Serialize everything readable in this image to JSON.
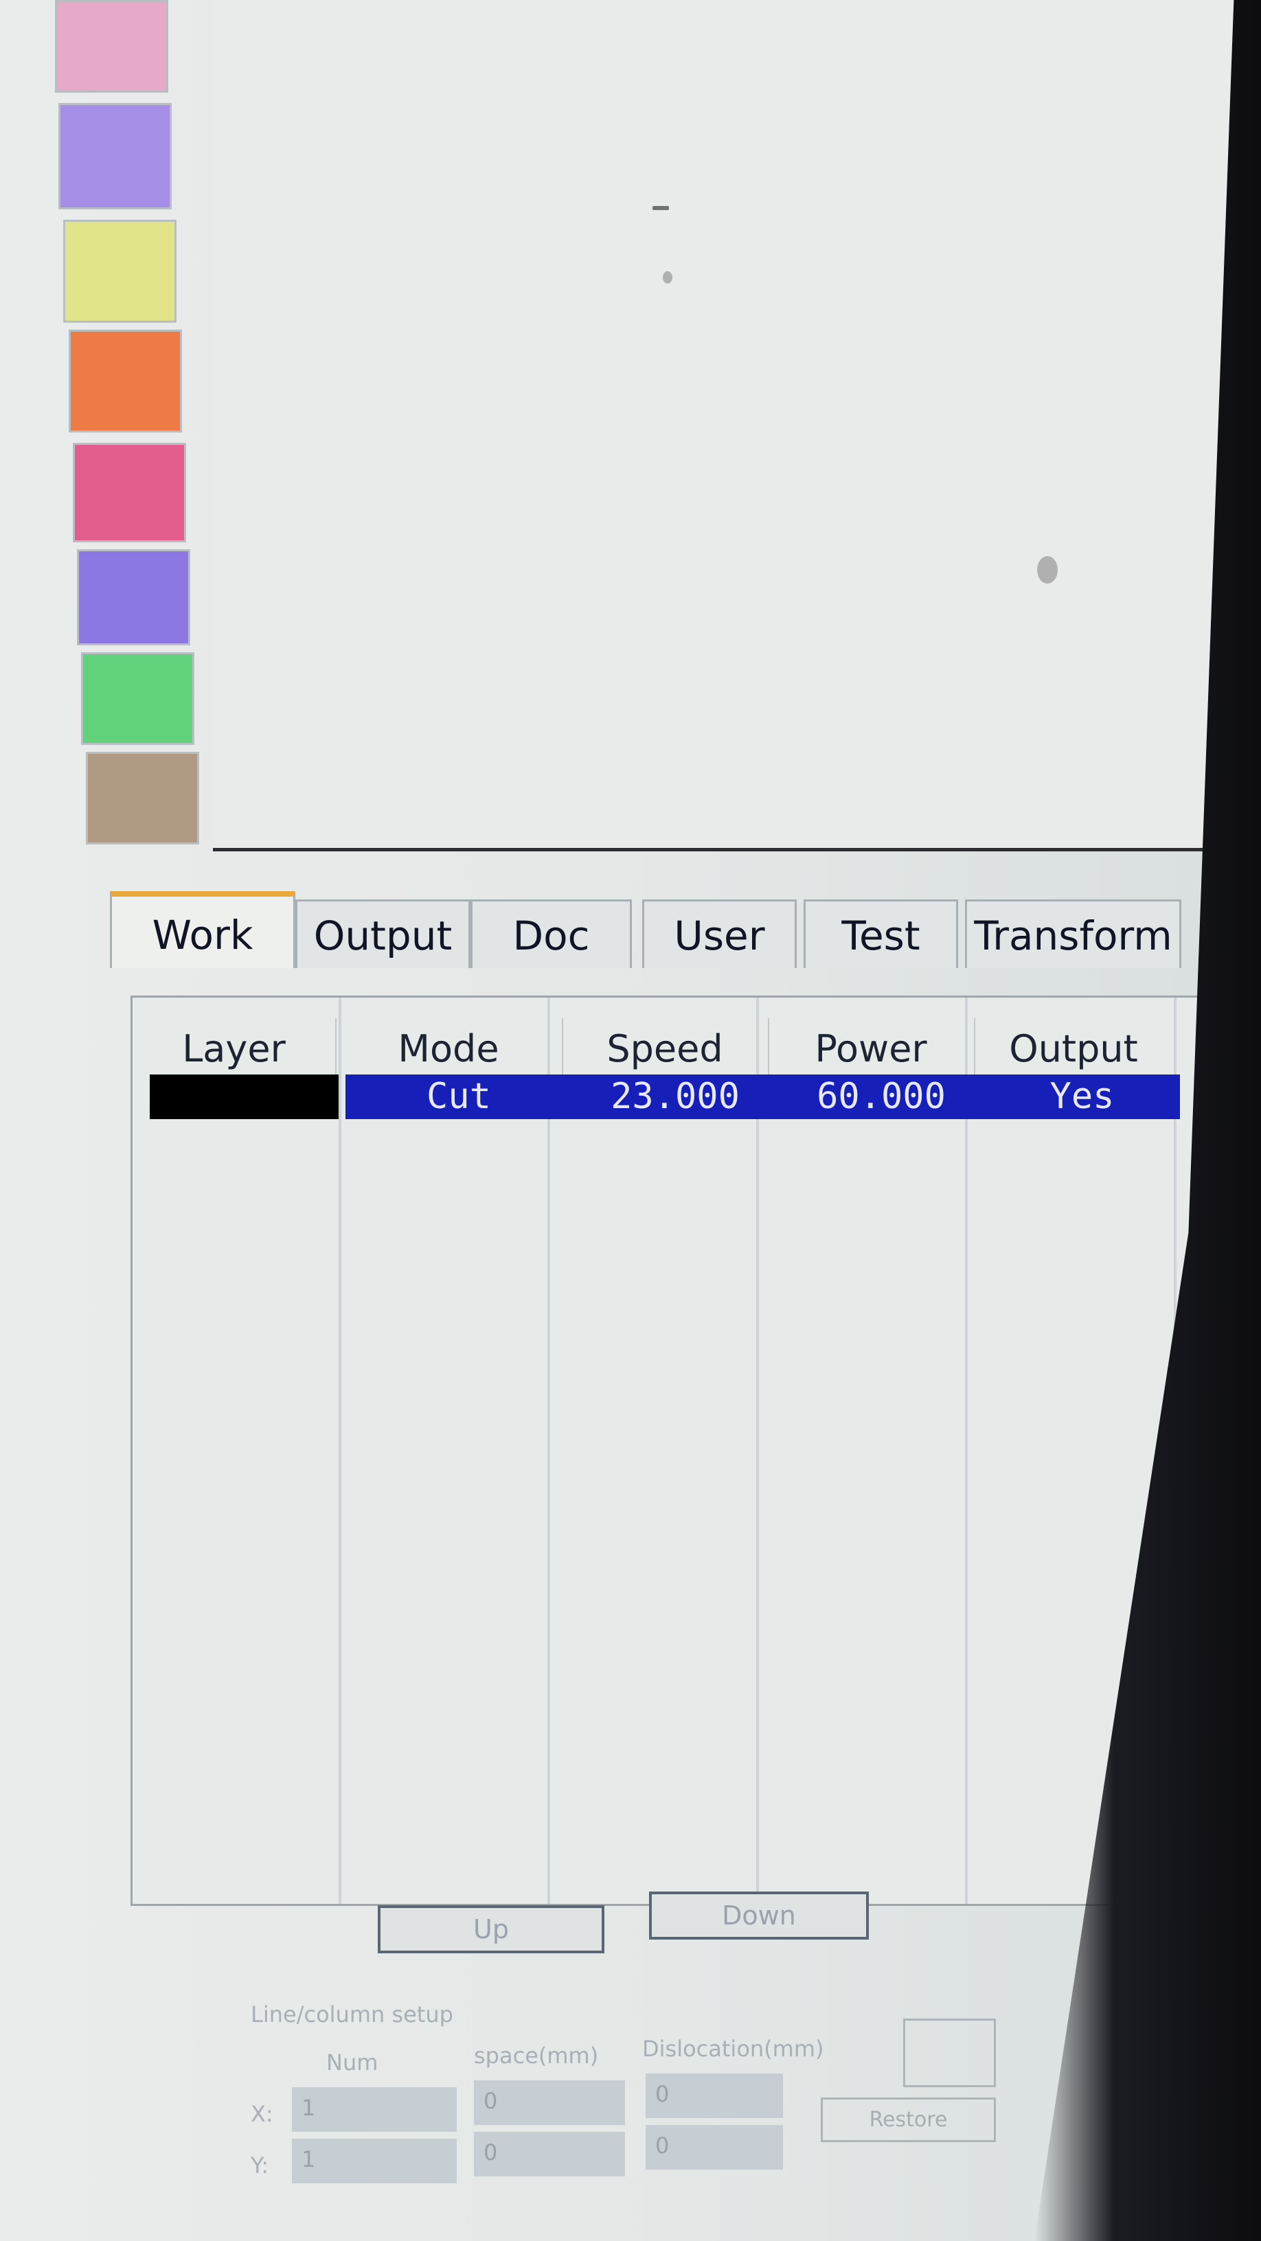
{
  "palette": {
    "colors": [
      "#e6aac8",
      "#a58ee6",
      "#e2e48a",
      "#ee7a45",
      "#e35d8d",
      "#8d77e3",
      "#62d27a",
      "#b09a84"
    ]
  },
  "tabs": [
    "Work",
    "Output",
    "Doc",
    "User",
    "Test",
    "Transform"
  ],
  "active_tab": "Work",
  "table": {
    "headers": [
      "Layer",
      "Mode",
      "Speed",
      "Power",
      "Output"
    ],
    "rows": [
      {
        "layer_color": "#000000",
        "mode": "Cut",
        "speed": "23.000",
        "power": "60.000",
        "output": "Yes"
      }
    ]
  },
  "buttons": {
    "up": "Up",
    "down": "Down"
  },
  "line_column": {
    "title": "Line/column setup",
    "num_label": "Num",
    "space_label": "space(mm)",
    "dislocation_label": "Dislocation(mm)",
    "x_label": "X:",
    "y_label": "Y:",
    "x_num": "1",
    "y_num": "1",
    "x_space": "0",
    "y_space": "0",
    "x_disloc": "0",
    "y_disloc": "0",
    "restore_label": "Restore"
  },
  "colors": {
    "selection": "#1620b8",
    "tab_accent": "#e9a83a"
  }
}
